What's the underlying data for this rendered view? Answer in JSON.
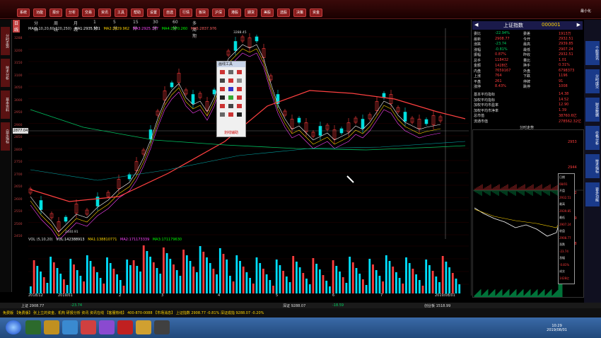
{
  "toolbar": {
    "buttons": [
      "系统",
      "功能",
      "报价",
      "分析",
      "交易",
      "资讯",
      "工具",
      "帮助",
      "设置",
      "自选",
      "行情",
      "板块",
      "沪深",
      "港股",
      "期货",
      "美股",
      "选股",
      "决策",
      "资金"
    ],
    "window_min": "最小化"
  },
  "chart_tabs": [
    "日线",
    "分钟",
    "周线",
    "月线",
    "1分",
    "5分",
    "15分",
    "30分",
    "60分",
    "多周期"
  ],
  "left_strip": [
    "分时走势",
    "技术分析",
    "基本资料",
    "自定指标"
  ],
  "right_strip": [
    "个股资讯",
    "分时成交",
    "财务数据",
    "价格分析",
    "技术指标",
    "更多功能"
  ],
  "legend": {
    "series": "MA(5,10,20,60,120,250)",
    "ma1": "MA1:2935.931",
    "ma2": "MA2:2929.962",
    "ma3": "MA3:2925.177",
    "ma4": "MA4:2970.260",
    "ma5": "MA5:2837.976"
  },
  "vol_legend": {
    "series": "VOL (5,10,20)",
    "vol": "VOL:142388913",
    "ma1": "MA1:138810771",
    "ma2": "MA2:171173339",
    "ma3": "MA3:171179630"
  },
  "y_labels": [
    "3288",
    "3200",
    "3150",
    "3100",
    "3050",
    "3000",
    "2950",
    "2900",
    "2850",
    "2800",
    "2750",
    "2700",
    "2650",
    "2600",
    "2550",
    "2500",
    "2450"
  ],
  "price_tag": "2877.04",
  "annotations": {
    "high": "3288.45",
    "low": "2440.91"
  },
  "x_labels": [
    "2018/12",
    "2019/01",
    "2",
    "3",
    "4",
    "5",
    "6",
    "7",
    "2019/08/01"
  ],
  "tools_panel": {
    "title": "画线工具",
    "footer": "划线辅助"
  },
  "right_panel": {
    "title": "上证指数",
    "code": "000001",
    "rows": [
      {
        "k": "委比",
        "v": "-22.94%",
        "k2": "委差",
        "v2": "1913万"
      },
      {
        "k": "最新",
        "v": "2908.77",
        "k2": "今开",
        "v2": "2932.51"
      },
      {
        "k": "涨跌",
        "v": "-23.74",
        "k2": "最高",
        "v2": "2939.85"
      },
      {
        "k": "涨幅",
        "v": "-0.81%",
        "k2": "最低",
        "v2": "2907.24"
      },
      {
        "k": "振幅",
        "v": "0.87%",
        "k2": "昨收",
        "v2": "2932.51"
      },
      {
        "k": "总手",
        "v": "118432",
        "k2": "量比",
        "v2": "1.01"
      },
      {
        "k": "金额",
        "v": "1428亿",
        "k2": "换手",
        "v2": "0.31%"
      },
      {
        "k": "内盘",
        "v": "7659167",
        "k2": "外盘",
        "v2": "6798373"
      },
      {
        "k": "上涨",
        "v": "764",
        "k2": "下跌",
        "v2": "1196"
      },
      {
        "k": "平盘",
        "v": "261",
        "k2": "停牌",
        "v2": "91"
      },
      {
        "k": "涨停",
        "v": "8.43%",
        "k2": "跌停",
        "v2": "1008"
      }
    ],
    "extra": [
      {
        "k": "基本平均指标",
        "v": "14.38"
      },
      {
        "k": "加权平均指标",
        "v": "14.52"
      },
      {
        "k": "加权平均市盈率",
        "v": "12.90"
      },
      {
        "k": "加权平均市净率",
        "v": "1.39"
      },
      {
        "k": "总市值",
        "v": "38760.6亿"
      },
      {
        "k": "流通市值",
        "v": "278562.32亿"
      }
    ],
    "mini_title": "分时走势",
    "mini_labels": [
      "2953",
      "2944",
      "2932",
      "2919",
      "2908"
    ],
    "popup": [
      "日期",
      "08/01",
      "开盘",
      "2932.51",
      "最高",
      "2939.85",
      "最低",
      "2907.24",
      "收盘",
      "2908.77",
      "涨跌",
      "-23.74",
      "涨幅",
      "-0.81%",
      "成交",
      "1428亿"
    ]
  },
  "status_bar": {
    "sh": "上证 2908.77",
    "sh_chg": "-23.74",
    "sz": "深证 9288.07",
    "sz_chg": "-18.59",
    "cyb": "创业板 1518.99"
  },
  "ticker": "免费版   【免费版】 张上立的资金、机构 研报分析   资讯 资讯在线   【客服热线】 400-870-0088   【市场消息】 上证指数 2908.77 -0.81%   深证成指 9288.07 -0.20%",
  "clock": {
    "time": "10:29",
    "date": "2019/08/01"
  }
}
